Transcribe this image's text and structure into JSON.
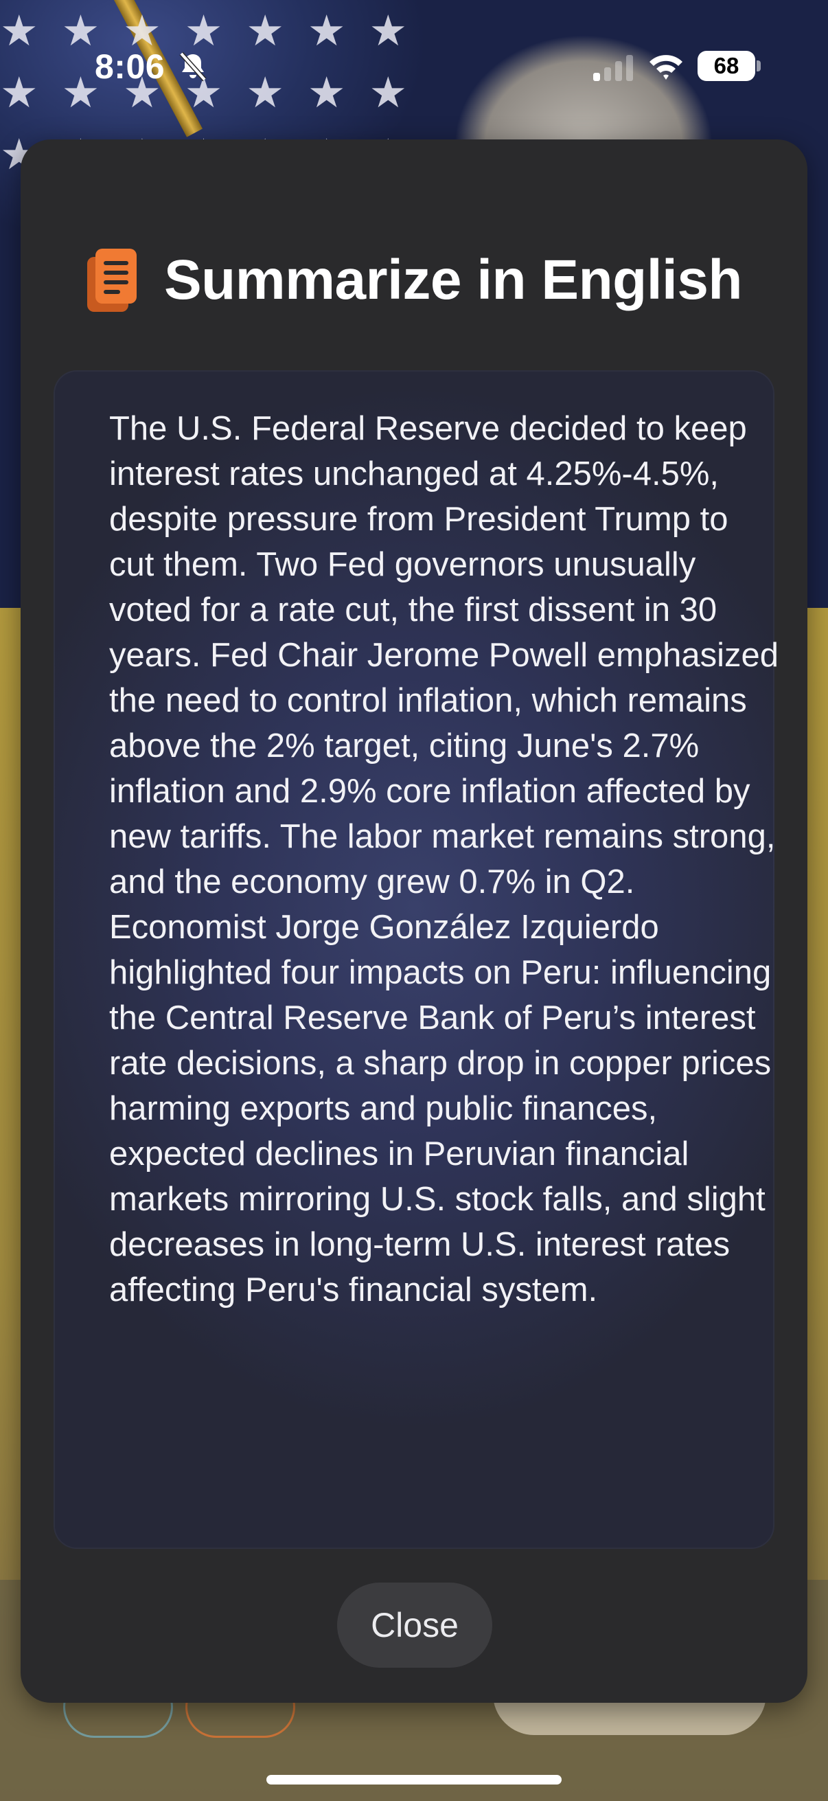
{
  "status_bar": {
    "time": "8:06",
    "battery": "68",
    "icons": [
      "bell-slash-icon",
      "cellular-signal-icon",
      "wifi-icon",
      "battery-icon"
    ]
  },
  "sheet": {
    "title": "Summarize in English",
    "title_icon": "document-icon",
    "summary": "The U.S. Federal Reserve decided to keep interest rates unchanged at 4.25%-4.5%, despite pressure from President Trump to cut them. Two Fed governors unusually voted for a rate cut, the first dissent in 30 years. Fed Chair Jerome Powell emphasized the need to control inflation, which remains above the 2% target, citing June's 2.7% inflation and 2.9% core inflation affected by new tariffs. The labor market remains strong, and the economy grew 0.7% in Q2. Economist Jorge González Izquierdo highlighted four impacts on Peru: influencing the Central Reserve Bank of Peru’s interest rate decisions, a sharp drop in copper prices harming exports and public finances, expected declines in Peruvian financial markets mirroring U.S. stock falls, and slight decreases in long-term U.S. interest rates affecting Peru's financial system.",
    "close_label": "Close"
  },
  "colors": {
    "sheet_background": "#2a2a2c",
    "accent_orange": "#f07a33",
    "close_button": "#3c3c3f"
  }
}
